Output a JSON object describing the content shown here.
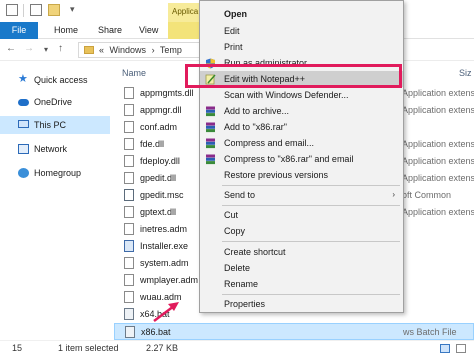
{
  "ribbon": {
    "tabs": [
      "File",
      "Home",
      "Share",
      "View"
    ],
    "contextual_tab": "Applica"
  },
  "address": {
    "path": [
      "«",
      "Windows",
      "Temp"
    ]
  },
  "sidebar": {
    "items": [
      {
        "label": "Quick access",
        "icon": "star-icon"
      },
      {
        "label": "OneDrive",
        "icon": "cloud-icon"
      },
      {
        "label": "This PC",
        "icon": "computer-icon",
        "selected": true
      },
      {
        "label": "Network",
        "icon": "network-icon"
      },
      {
        "label": "Homegroup",
        "icon": "homegroup-icon"
      }
    ]
  },
  "filelist": {
    "columns": {
      "name": "Name",
      "size": "Siz"
    },
    "rows": [
      {
        "name": "appmgmts.dll",
        "type": "Application extens"
      },
      {
        "name": "appmgr.dll",
        "type": "Application extens"
      },
      {
        "name": "conf.adm",
        "type": ""
      },
      {
        "name": "fde.dll",
        "type": "Application extens"
      },
      {
        "name": "fdeploy.dll",
        "type": "Application extens"
      },
      {
        "name": "gpedit.dll",
        "type": "Application extens"
      },
      {
        "name": "gpedit.msc",
        "type": "oft Common"
      },
      {
        "name": "gptext.dll",
        "type": "Application extens"
      },
      {
        "name": "inetres.adm",
        "type": ""
      },
      {
        "name": "Installer.exe",
        "type": ""
      },
      {
        "name": "system.adm",
        "type": ""
      },
      {
        "name": "wmplayer.adm",
        "type": ""
      },
      {
        "name": "wuau.adm",
        "type": ""
      },
      {
        "name": "x64.bat",
        "type": ""
      },
      {
        "name": "x86.bat",
        "type": "ws Batch File",
        "selected": true
      }
    ]
  },
  "status": {
    "count": "15",
    "selected": "1 item selected",
    "size": "2.27 KB"
  },
  "context_menu": {
    "items": [
      {
        "label": "Open",
        "bold": true
      },
      {
        "label": "Edit"
      },
      {
        "label": "Print"
      },
      {
        "label": "Run as administrator",
        "icon": "shield-icon"
      },
      {
        "label": "Edit with Notepad++",
        "icon": "notepadpp-icon",
        "highlighted": true
      },
      {
        "label": "Scan with Windows Defender...",
        "icon": "defender-icon"
      },
      {
        "label": "Add to archive...",
        "icon": "winrar-icon"
      },
      {
        "label": "Add to \"x86.rar\"",
        "icon": "winrar-icon"
      },
      {
        "label": "Compress and email...",
        "icon": "winrar-icon"
      },
      {
        "label": "Compress to \"x86.rar\" and email",
        "icon": "winrar-icon"
      },
      {
        "label": "Restore previous versions"
      },
      {
        "label": "Send to",
        "submenu": true
      },
      {
        "label": "Cut"
      },
      {
        "label": "Copy"
      },
      {
        "label": "Create shortcut"
      },
      {
        "label": "Delete"
      },
      {
        "label": "Rename"
      },
      {
        "label": "Properties"
      }
    ]
  },
  "colors": {
    "file_tab": "#1979ca",
    "highlight_box": "#e11b5c",
    "selection": "#cce8ff"
  }
}
